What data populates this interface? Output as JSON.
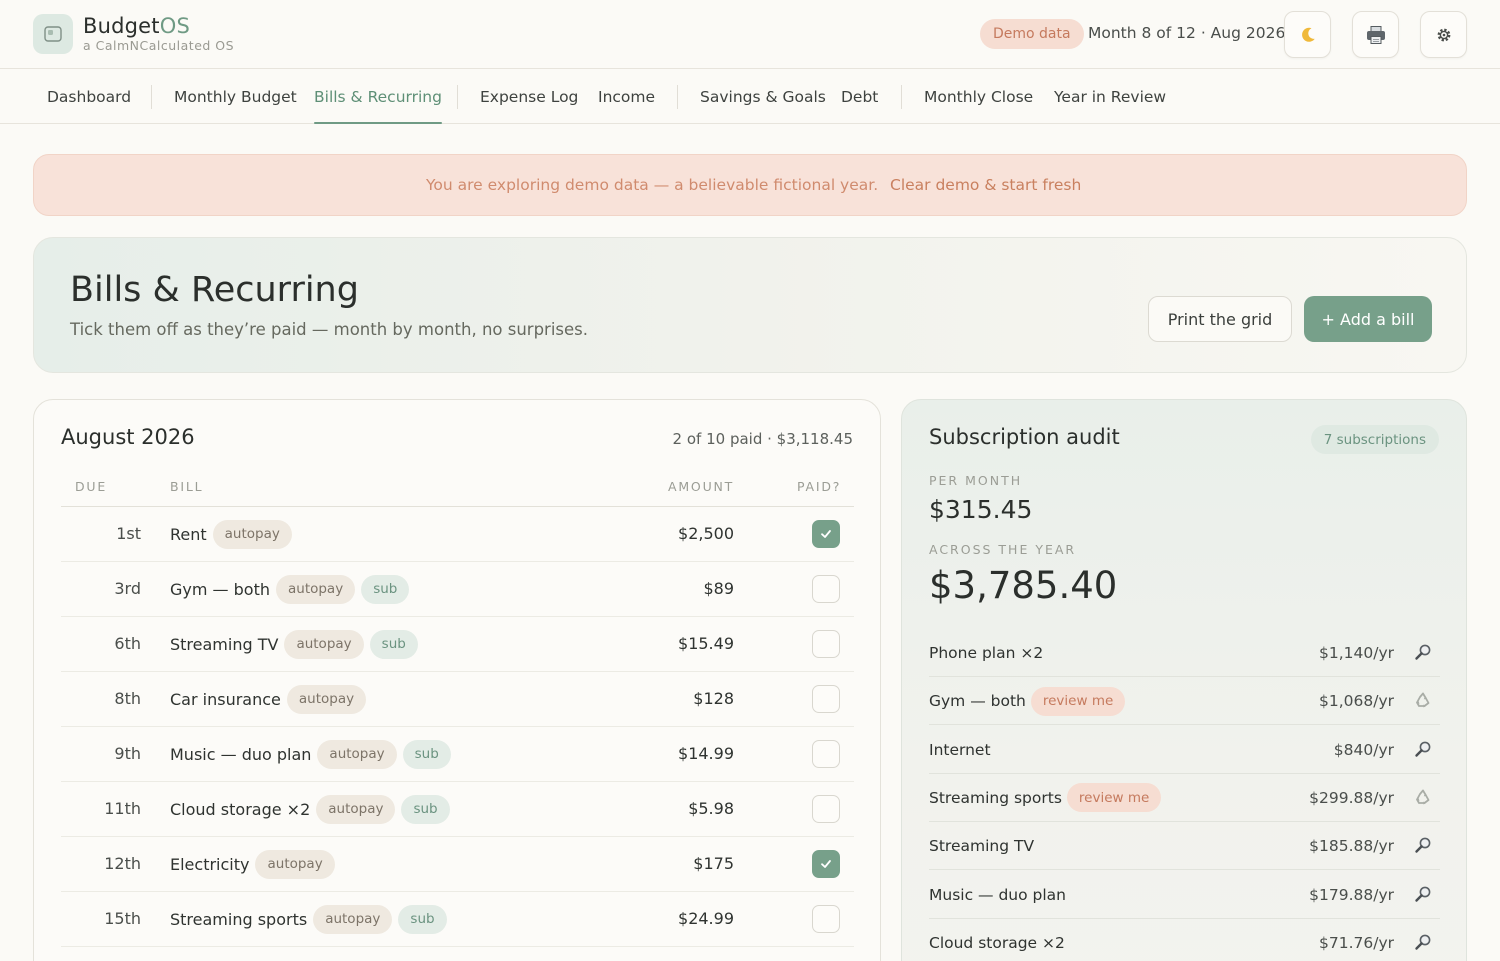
{
  "app": {
    "name_main": "Budget",
    "name_accent": "OS",
    "tagline": "a CalmNCalculated OS",
    "demo_badge": "Demo data",
    "month_status": "Month 8 of 12 · Aug 2026"
  },
  "header_icons": [
    "moon-icon",
    "printer-icon",
    "gear-icon"
  ],
  "nav": [
    {
      "label": "Dashboard"
    },
    {
      "label": "Monthly Budget"
    },
    {
      "label": "Bills & Recurring",
      "active": true
    },
    {
      "label": "Expense Log"
    },
    {
      "label": "Income"
    },
    {
      "label": "Savings & Goals"
    },
    {
      "label": "Debt"
    },
    {
      "label": "Monthly Close"
    },
    {
      "label": "Year in Review"
    }
  ],
  "banner": {
    "message": "You are exploring demo data — a believable fictional year.",
    "link": "Clear demo & start fresh"
  },
  "hero": {
    "title": "Bills & Recurring",
    "subtitle": "Tick them off as they’re paid — month by month, no surprises.",
    "print_label": "Print the grid",
    "add_label": "+ Add a bill"
  },
  "bills": {
    "title": "August 2026",
    "summary": "2 of 10 paid · $3,118.45",
    "columns": {
      "due": "DUE",
      "bill": "BILL",
      "amount": "AMOUNT",
      "paid": "PAID?"
    },
    "rows": [
      {
        "due": "1st",
        "name": "Rent",
        "tags": [
          "autopay"
        ],
        "amount": "$2,500",
        "paid": true
      },
      {
        "due": "3rd",
        "name": "Gym — both",
        "tags": [
          "autopay",
          "sub"
        ],
        "amount": "$89",
        "paid": false
      },
      {
        "due": "6th",
        "name": "Streaming TV",
        "tags": [
          "autopay",
          "sub"
        ],
        "amount": "$15.49",
        "paid": false
      },
      {
        "due": "8th",
        "name": "Car insurance",
        "tags": [
          "autopay"
        ],
        "amount": "$128",
        "paid": false
      },
      {
        "due": "9th",
        "name": "Music — duo plan",
        "tags": [
          "autopay",
          "sub"
        ],
        "amount": "$14.99",
        "paid": false
      },
      {
        "due": "11th",
        "name": "Cloud storage ×2",
        "tags": [
          "autopay",
          "sub"
        ],
        "amount": "$5.98",
        "paid": false
      },
      {
        "due": "12th",
        "name": "Electricity",
        "tags": [
          "autopay"
        ],
        "amount": "$175",
        "paid": true
      },
      {
        "due": "15th",
        "name": "Streaming sports",
        "tags": [
          "autopay",
          "sub"
        ],
        "amount": "$24.99",
        "paid": false
      }
    ]
  },
  "audit": {
    "title": "Subscription audit",
    "badge": "7 subscriptions",
    "per_month_label": "PER MONTH",
    "per_month": "$315.45",
    "per_year_label": "ACROSS THE YEAR",
    "per_year": "$3,785.40",
    "rows": [
      {
        "name": "Phone plan ×2",
        "tag": "",
        "cost": "$1,140/yr",
        "icon": "magnifier-icon"
      },
      {
        "name": "Gym — both",
        "tag": "review me",
        "cost": "$1,068/yr",
        "icon": "recycle-icon"
      },
      {
        "name": "Internet",
        "tag": "",
        "cost": "$840/yr",
        "icon": "magnifier-icon"
      },
      {
        "name": "Streaming sports",
        "tag": "review me",
        "cost": "$299.88/yr",
        "icon": "recycle-icon"
      },
      {
        "name": "Streaming TV",
        "tag": "",
        "cost": "$185.88/yr",
        "icon": "magnifier-icon"
      },
      {
        "name": "Music — duo plan",
        "tag": "",
        "cost": "$179.88/yr",
        "icon": "magnifier-icon"
      },
      {
        "name": "Cloud storage ×2",
        "tag": "",
        "cost": "$71.76/yr",
        "icon": "magnifier-icon"
      }
    ]
  },
  "colors": {
    "accent": "#77a08a",
    "accent_text": "#5e8f76",
    "warn_bg": "#f6ddd2",
    "warn_text": "#c57a5e",
    "page_bg": "#fbfaf6"
  }
}
